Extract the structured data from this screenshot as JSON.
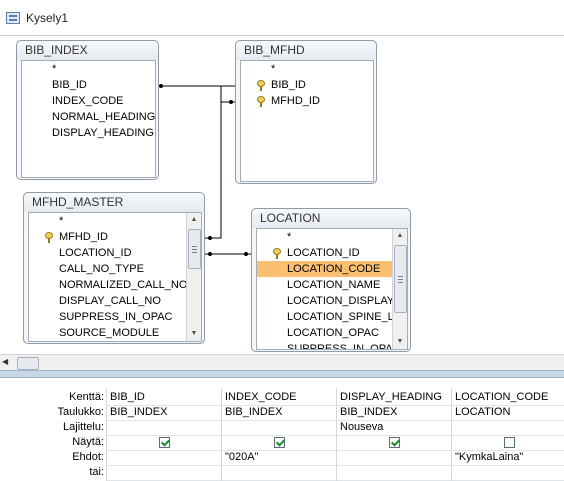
{
  "window": {
    "title": "Kysely1"
  },
  "tables": {
    "bib_index": {
      "name": "BIB_INDEX",
      "fields": [
        "*",
        "BIB_ID",
        "INDEX_CODE",
        "NORMAL_HEADING",
        "DISPLAY_HEADING"
      ]
    },
    "bib_mfhd": {
      "name": "BIB_MFHD",
      "fields": [
        "*",
        "BIB_ID",
        "MFHD_ID"
      ]
    },
    "mfhd_master": {
      "name": "MFHD_MASTER",
      "fields": [
        "*",
        "MFHD_ID",
        "LOCATION_ID",
        "CALL_NO_TYPE",
        "NORMALIZED_CALL_NO",
        "DISPLAY_CALL_NO",
        "SUPPRESS_IN_OPAC",
        "SOURCE_MODULE"
      ]
    },
    "location": {
      "name": "LOCATION",
      "fields": [
        "*",
        "LOCATION_ID",
        "LOCATION_CODE",
        "LOCATION_NAME",
        "LOCATION_DISPLAY_N",
        "LOCATION_SPINE_LAI",
        "LOCATION_OPAC",
        "SUPPRESS_IN_OPAC"
      ],
      "selected": "LOCATION_CODE"
    }
  },
  "grid": {
    "row_labels": [
      "Kenttä:",
      "Taulukko:",
      "Lajittelu:",
      "Näytä:",
      "Ehdot:",
      "tai:"
    ],
    "columns": [
      {
        "field": "BIB_ID",
        "table": "BIB_INDEX",
        "sort": "",
        "show": true,
        "criteria": ""
      },
      {
        "field": "INDEX_CODE",
        "table": "BIB_INDEX",
        "sort": "",
        "show": true,
        "criteria": "\"020A\""
      },
      {
        "field": "DISPLAY_HEADING",
        "table": "BIB_INDEX",
        "sort": "Nouseva",
        "show": true,
        "criteria": ""
      },
      {
        "field": "LOCATION_CODE",
        "table": "LOCATION",
        "sort": "",
        "show": false,
        "criteria": "\"KymkaLaina\""
      }
    ]
  }
}
